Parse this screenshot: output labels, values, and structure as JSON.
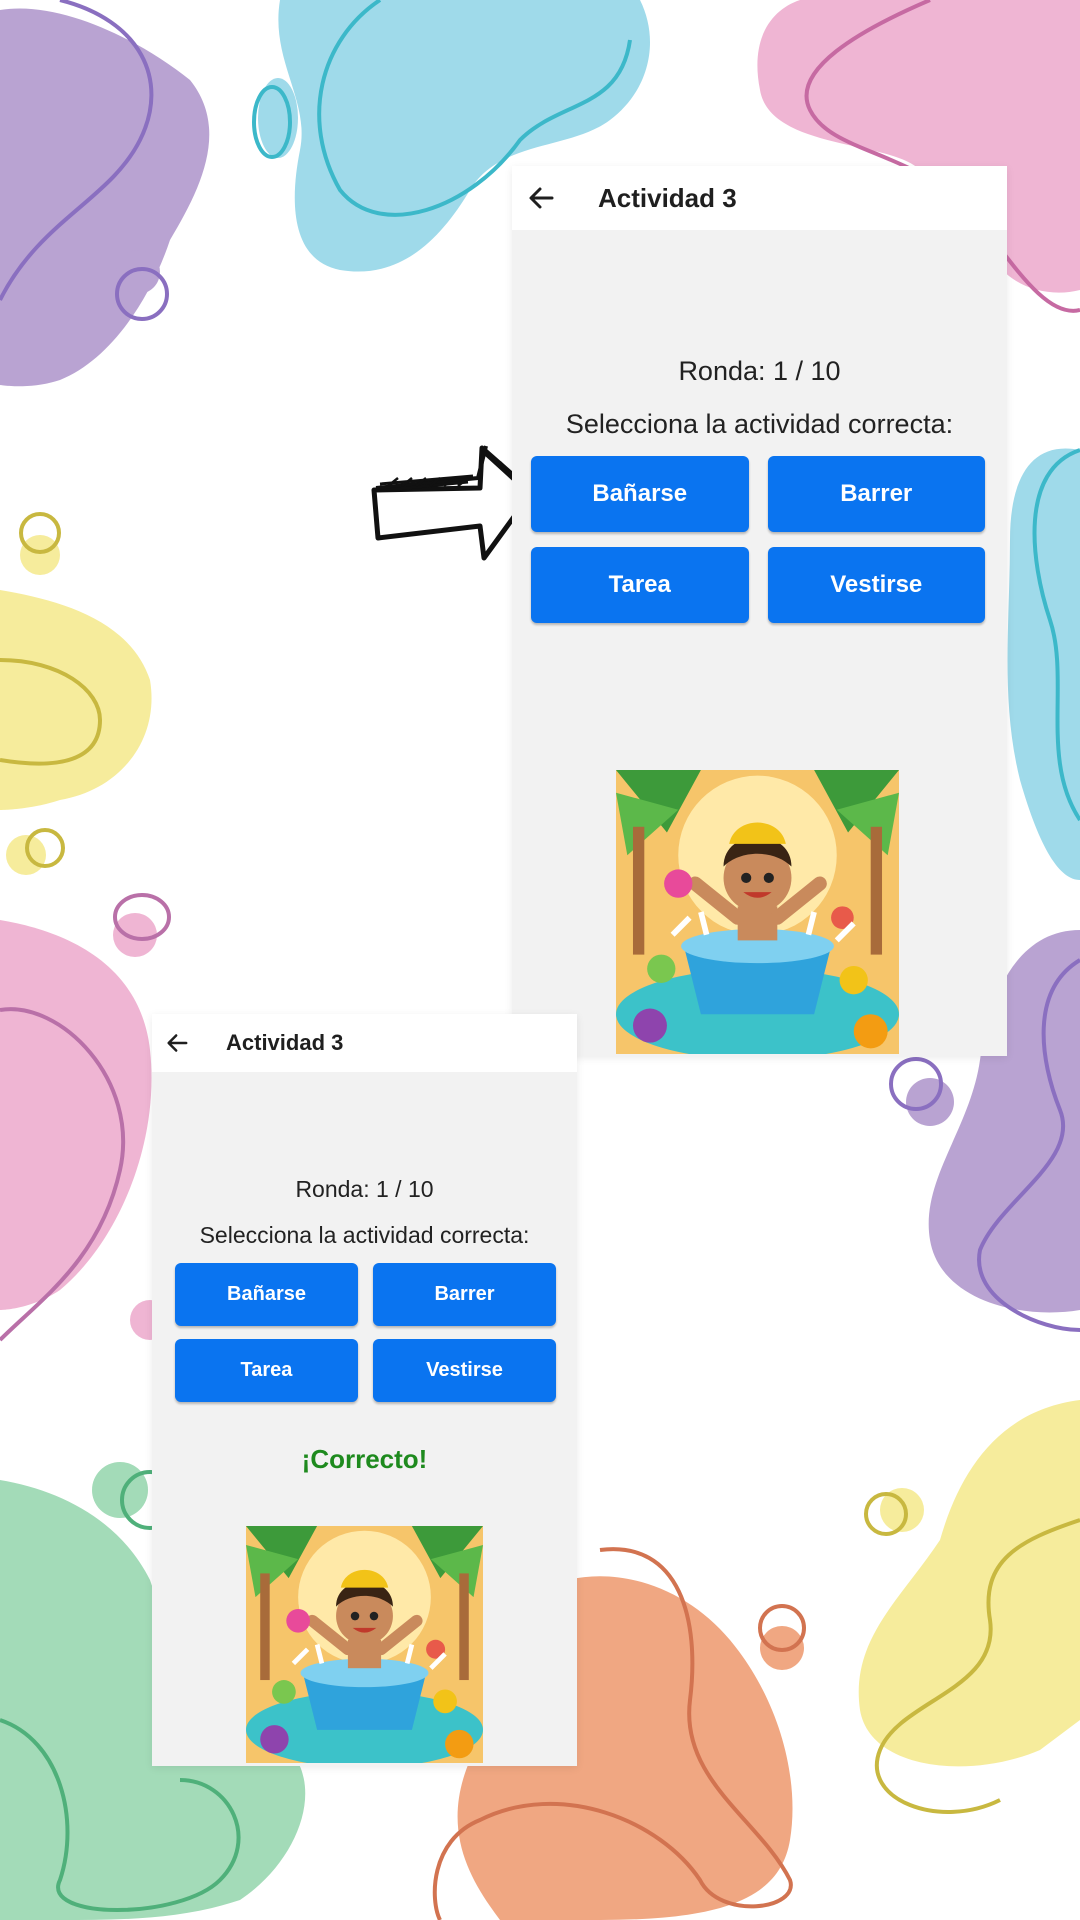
{
  "screens": [
    {
      "title": "Actividad 3",
      "round": "Ronda: 1 / 10",
      "prompt": "Selecciona la actividad correcta:",
      "options": [
        "Bañarse",
        "Barrer",
        "Tarea",
        "Vestirse"
      ],
      "feedback": ""
    },
    {
      "title": "Actividad 3",
      "round": "Ronda: 1 / 10",
      "prompt": "Selecciona la actividad correcta:",
      "options": [
        "Bañarse",
        "Barrer",
        "Tarea",
        "Vestirse"
      ],
      "feedback": "¡Correcto!"
    }
  ],
  "icons": {
    "back": "arrow-left-icon",
    "pointer": "hand-drawn-arrow-icon",
    "illustration": "child-bathing-illustration"
  },
  "colors": {
    "button": "#0a74f0",
    "feedback": "#1e8a1e",
    "screen_bg": "#f2f2f2",
    "appbar_bg": "#ffffff"
  }
}
